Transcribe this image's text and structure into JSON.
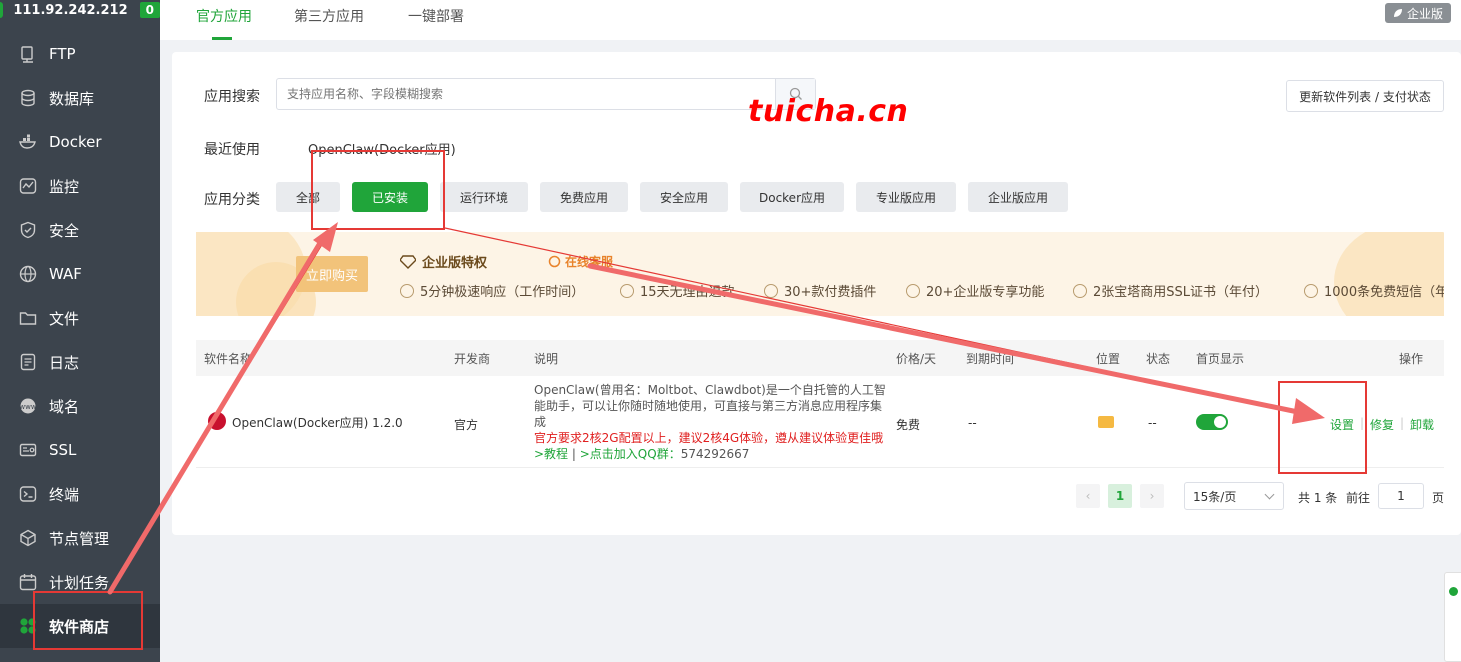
{
  "sidebar": {
    "server_ip": "111.92.242.212",
    "badge_count": "0",
    "items": [
      {
        "label": "FTP",
        "icon": "ftp-icon"
      },
      {
        "label": "数据库",
        "icon": "database-icon"
      },
      {
        "label": "Docker",
        "icon": "docker-icon"
      },
      {
        "label": "监控",
        "icon": "monitor-icon"
      },
      {
        "label": "安全",
        "icon": "shield-icon"
      },
      {
        "label": "WAF",
        "icon": "globe-icon"
      },
      {
        "label": "文件",
        "icon": "folder-icon"
      },
      {
        "label": "日志",
        "icon": "log-icon"
      },
      {
        "label": "域名",
        "icon": "domain-icon"
      },
      {
        "label": "SSL",
        "icon": "ssl-icon"
      },
      {
        "label": "终端",
        "icon": "terminal-icon"
      },
      {
        "label": "节点管理",
        "icon": "node-icon"
      },
      {
        "label": "计划任务",
        "icon": "calendar-icon"
      },
      {
        "label": "软件商店",
        "icon": "store-icon"
      }
    ]
  },
  "topbar": {
    "tabs": [
      "官方应用",
      "第三方应用",
      "一键部署"
    ],
    "edition_badge": "企业版"
  },
  "filters": {
    "search_label": "应用搜索",
    "search_placeholder": "支持应用名称、字段模糊搜索",
    "refresh_button": "更新软件列表 / 支付状态",
    "recent_label": "最近使用",
    "recent_app": "OpenClaw(Docker应用)",
    "category_label": "应用分类",
    "categories": [
      "全部",
      "已安装",
      "运行环境",
      "免费应用",
      "安全应用",
      "Docker应用",
      "专业版应用",
      "企业版应用"
    ],
    "active_category": "已安装"
  },
  "banner": {
    "buy_button": "立即购买",
    "title": "企业版特权",
    "service_link": "在线客服",
    "features": [
      "5分钟极速响应（工作时间）",
      "15天无理由退款",
      "30+款付费插件",
      "20+企业版专享功能",
      "2张宝塔商用SSL证书（年付）",
      "1000条免费短信（年"
    ]
  },
  "table": {
    "headers": [
      "软件名称",
      "开发商",
      "说明",
      "价格/天",
      "到期时间",
      "位置",
      "状态",
      "首页显示",
      "操作"
    ],
    "rows": [
      {
        "name": "OpenClaw(Docker应用) 1.2.0",
        "developer": "官方",
        "description": "OpenClaw(曾用名：Moltbot、Clawdbot)是一个自托管的人工智能助手，可以让你随时随地使用，可直接与第三方消息应用程序集成",
        "warning": "官方要求2核2G配置以上，建议2核4G体验，遵从建议体验更佳哦",
        "tutorial_link": ">教程",
        "qq_link": ">点击加入QQ群：",
        "qq_number": "574292667",
        "price": "免费",
        "expiry": "--",
        "status": "--",
        "homepage_display": true,
        "actions": [
          "设置",
          "修复",
          "卸载"
        ]
      }
    ]
  },
  "pagination": {
    "current_page": "1",
    "page_size": "15条/页",
    "total_text": "共 1 条",
    "goto_label": "前往",
    "goto_value": "1",
    "page_suffix": "页"
  },
  "watermark": "tuicha.cn",
  "colors": {
    "brand_green": "#20a53a",
    "sidebar_bg": "#3c444d",
    "annotation_red": "#e53935"
  }
}
